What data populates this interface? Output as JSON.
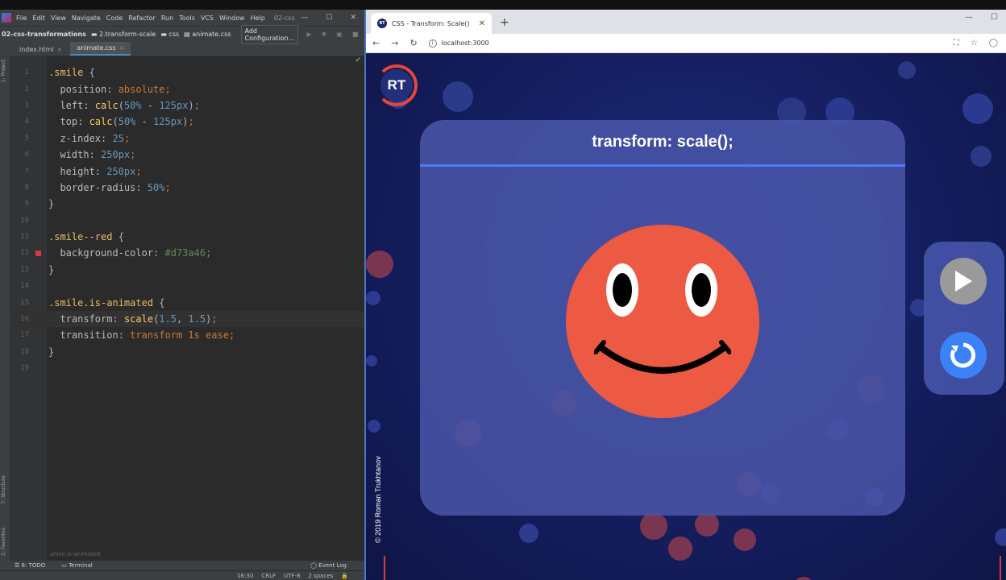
{
  "ide": {
    "menu": [
      "File",
      "Edit",
      "View",
      "Navigate",
      "Code",
      "Refactor",
      "Run",
      "Tools",
      "VCS",
      "Window",
      "Help"
    ],
    "project_title": "02-css",
    "breadcrumbs": [
      "02-css-transformations",
      "2.transform-scale",
      "css",
      "animate.css"
    ],
    "add_configuration": "Add Configuration...",
    "tabs": [
      {
        "label": "index.html"
      },
      {
        "label": "animate.css"
      }
    ],
    "code_lines": [
      {
        "n": "1",
        "parts": [
          [
            ".smile",
            "sel"
          ],
          [
            " {",
            "pn"
          ]
        ]
      },
      {
        "n": "2",
        "parts": [
          [
            "  position",
            "prop"
          ],
          [
            ": ",
            "pn"
          ],
          [
            "absolute",
            "val"
          ],
          [
            ";",
            "val"
          ]
        ]
      },
      {
        "n": "3",
        "parts": [
          [
            "  left",
            "prop"
          ],
          [
            ": ",
            "pn"
          ],
          [
            "calc",
            "fn"
          ],
          [
            "(",
            "pn"
          ],
          [
            "50%",
            "num"
          ],
          [
            " - ",
            "pn"
          ],
          [
            "125px",
            "num"
          ],
          [
            ")",
            "pn"
          ],
          [
            ";",
            "val"
          ]
        ]
      },
      {
        "n": "4",
        "parts": [
          [
            "  top",
            "prop"
          ],
          [
            ": ",
            "pn"
          ],
          [
            "calc",
            "fn"
          ],
          [
            "(",
            "pn"
          ],
          [
            "50%",
            "num"
          ],
          [
            " - ",
            "pn"
          ],
          [
            "125px",
            "num"
          ],
          [
            ")",
            "pn"
          ],
          [
            ";",
            "val"
          ]
        ]
      },
      {
        "n": "5",
        "parts": [
          [
            "  z-index",
            "prop"
          ],
          [
            ": ",
            "pn"
          ],
          [
            "25",
            "num"
          ],
          [
            ";",
            "val"
          ]
        ]
      },
      {
        "n": "6",
        "parts": [
          [
            "  width",
            "prop"
          ],
          [
            ": ",
            "pn"
          ],
          [
            "250px",
            "num"
          ],
          [
            ";",
            "val"
          ]
        ]
      },
      {
        "n": "7",
        "parts": [
          [
            "  height",
            "prop"
          ],
          [
            ": ",
            "pn"
          ],
          [
            "250px",
            "num"
          ],
          [
            ";",
            "val"
          ]
        ]
      },
      {
        "n": "8",
        "parts": [
          [
            "  border-radius",
            "prop"
          ],
          [
            ": ",
            "pn"
          ],
          [
            "50%",
            "num"
          ],
          [
            ";",
            "val"
          ]
        ]
      },
      {
        "n": "9",
        "parts": [
          [
            "}",
            "pn"
          ]
        ]
      },
      {
        "n": "10",
        "parts": []
      },
      {
        "n": "11",
        "parts": [
          [
            ".smile--red",
            "sel"
          ],
          [
            " {",
            "pn"
          ]
        ]
      },
      {
        "n": "12",
        "parts": [
          [
            "  background-color",
            "prop"
          ],
          [
            ": ",
            "pn"
          ],
          [
            "#d73a46",
            "hex"
          ],
          [
            ";",
            "val"
          ]
        ],
        "swatch": "#d73a46"
      },
      {
        "n": "13",
        "parts": [
          [
            "}",
            "pn"
          ]
        ]
      },
      {
        "n": "14",
        "parts": []
      },
      {
        "n": "15",
        "parts": [
          [
            ".smile.is-animated",
            "sel"
          ],
          [
            " {",
            "pn"
          ]
        ]
      },
      {
        "n": "16",
        "parts": [
          [
            "  transform",
            "prop"
          ],
          [
            ": ",
            "pn"
          ],
          [
            "scale",
            "fn"
          ],
          [
            "(",
            "pn"
          ],
          [
            "1.5",
            "num"
          ],
          [
            ", ",
            "pn"
          ],
          [
            "1.5",
            "num"
          ],
          [
            ")",
            "pn"
          ],
          [
            ";",
            "val"
          ]
        ],
        "current": true
      },
      {
        "n": "17",
        "parts": [
          [
            "  transition",
            "prop"
          ],
          [
            ": ",
            "pn"
          ],
          [
            "transform 1s ease",
            "val"
          ],
          [
            ";",
            "val"
          ]
        ]
      },
      {
        "n": "18",
        "parts": [
          [
            "}",
            "pn"
          ]
        ]
      },
      {
        "n": "19",
        "parts": []
      }
    ],
    "status_crumb": ".smile.is-animated",
    "todo": "6: TODO",
    "terminal": "Terminal",
    "event_log": "Event Log",
    "status": {
      "position": "16:30",
      "line_sep": "CRLF",
      "encoding": "UTF-8",
      "indent": "2 spaces"
    }
  },
  "browser": {
    "tab_title": "CSS - Transform: Scale()",
    "url": "localhost:3000"
  },
  "page": {
    "logo": "RT",
    "title": "transform: scale();",
    "copyright": "© 2019 Roman Trukhtanov"
  },
  "colors": {
    "smile": "#ec5a44",
    "accent": "#4f7cff",
    "reset": "#3b82f6"
  }
}
